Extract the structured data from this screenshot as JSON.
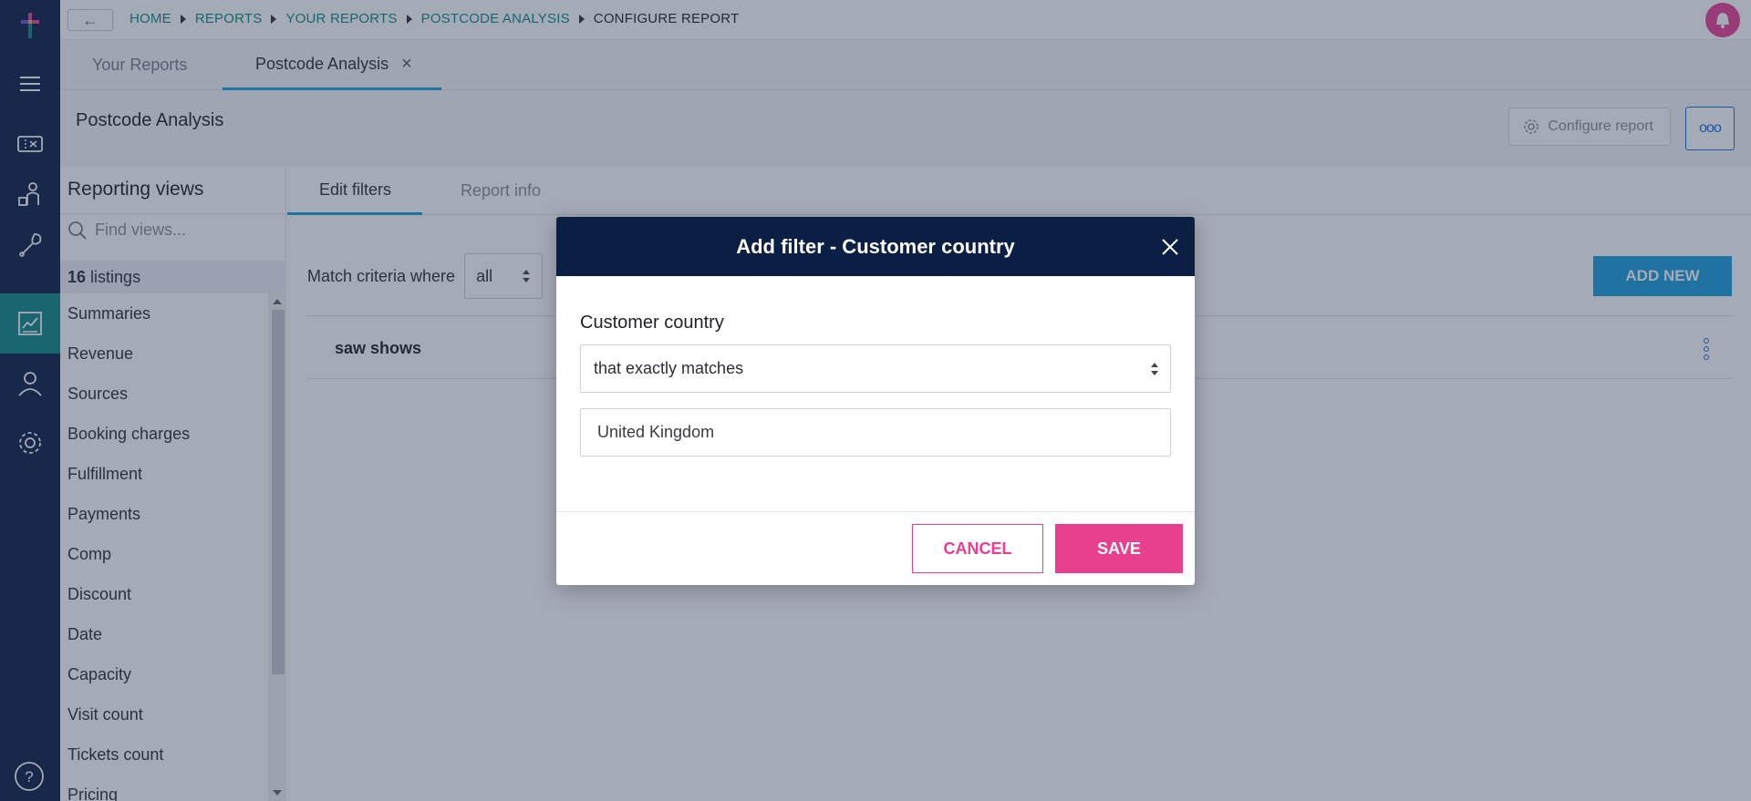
{
  "breadcrumbs": [
    "HOME",
    "REPORTS",
    "YOUR REPORTS",
    "POSTCODE ANALYSIS",
    "CONFIGURE REPORT"
  ],
  "top_tabs": [
    {
      "label": "Your Reports"
    },
    {
      "label": "Postcode Analysis"
    }
  ],
  "page": {
    "title": "Postcode Analysis",
    "configure_label": "Configure report",
    "more_label": "ooo"
  },
  "views": {
    "title": "Reporting views",
    "search_placeholder": "Find views...",
    "count": "16",
    "count_suffix": "listings",
    "items": [
      "Summaries",
      "Revenue",
      "Sources",
      "Booking charges",
      "Fulfillment",
      "Payments",
      "Comp",
      "Discount",
      "Date",
      "Capacity",
      "Visit count",
      "Tickets count",
      "Pricing"
    ]
  },
  "main": {
    "tabs": [
      {
        "label": "Edit filters"
      },
      {
        "label": "Report info"
      }
    ],
    "match_label": "Match criteria where",
    "match_value": "all",
    "add_new_label": "ADD NEW",
    "filter_name": "saw shows"
  },
  "modal": {
    "title": "Add filter - Customer country",
    "field_label": "Customer country",
    "condition": "that exactly matches",
    "value": "United Kingdom",
    "cancel_label": "CANCEL",
    "save_label": "SAVE"
  },
  "icons": {
    "bell": "bell-icon",
    "back": "arrow-left-icon",
    "close": "close-icon"
  },
  "colors": {
    "rail": "#0b1f45",
    "rail_active": "#118a86",
    "accent_blue": "#1a9fd8",
    "pink": "#e8408f",
    "breadcrumb": "#118a86"
  }
}
